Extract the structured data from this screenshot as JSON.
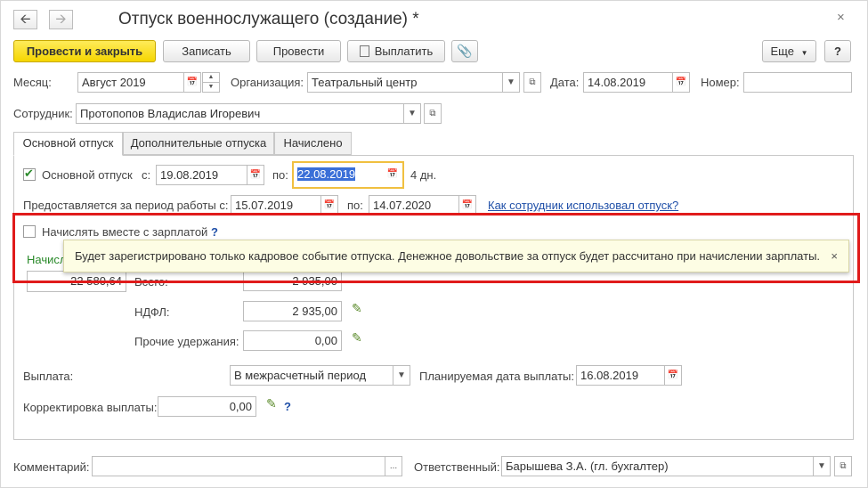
{
  "window": {
    "title": "Отпуск военнослужащего (создание) *",
    "back_icon": "arrow-left-icon",
    "forward_icon": "arrow-right-icon",
    "close_glyph": "×"
  },
  "toolbar": {
    "post_close": "Провести и закрыть",
    "save": "Записать",
    "post": "Провести",
    "pay": "Выплатить",
    "more": "Еще",
    "help": "?"
  },
  "header": {
    "month_label": "Месяц:",
    "month_value": "Август 2019",
    "org_label": "Организация:",
    "org_value": "Театральный центр",
    "date_label": "Дата:",
    "date_value": "14.08.2019",
    "number_label": "Номер:",
    "number_value": "",
    "employee_label": "Сотрудник:",
    "employee_value": "Протопопов Владислав Игоревич"
  },
  "tabs": [
    {
      "label": "Основной отпуск",
      "active": true
    },
    {
      "label": "Дополнительные отпуска",
      "active": false
    },
    {
      "label": "Начислено",
      "active": false
    }
  ],
  "leave": {
    "checkbox_label": "Основной отпуск",
    "checked": true,
    "from_label": "с:",
    "from_value": "19.08.2019",
    "to_label": "по:",
    "to_value": "22.08.2019",
    "days": "4 дн.",
    "period_label": "Предоставляется за период работы с:",
    "period_from": "15.07.2019",
    "period_to_label": "по:",
    "period_to": "14.07.2020",
    "usage_link": "Как сотрудник использовал отпуск?"
  },
  "salary": {
    "checkbox_label": "Начислять вместе с зарплатой",
    "checked": false,
    "help": "?",
    "accrued_label": "Начисл",
    "accrued_value": "22 580,64",
    "total_label": "Всего:",
    "total_value": "2 935,00",
    "ndfl_label": "НДФЛ:",
    "ndfl_value": "2 935,00",
    "other_label": "Прочие удержания:",
    "other_value": "0,00"
  },
  "tooltip": {
    "text": "Будет зарегистрировано только кадровое событие отпуска. Денежное довольствие за отпуск будет рассчитано при начислении зарплаты.",
    "close": "×"
  },
  "payment": {
    "label": "Выплата:",
    "value": "В межрасчетный период",
    "planned_label": "Планируемая дата выплаты:",
    "planned_value": "16.08.2019",
    "correction_label": "Корректировка выплаты:",
    "correction_value": "0,00",
    "help": "?"
  },
  "footer": {
    "comment_label": "Комментарий:",
    "comment_value": "",
    "responsible_label": "Ответственный:",
    "responsible_value": "Барышева З.А. (гл. бухгалтер)"
  },
  "colors": {
    "primary_button": "#f5d600",
    "link": "#1f4fa8",
    "highlight_border": "#e01b1b",
    "tooltip_bg": "#fdfde4",
    "selected_text_bg": "#3a6fd8"
  }
}
